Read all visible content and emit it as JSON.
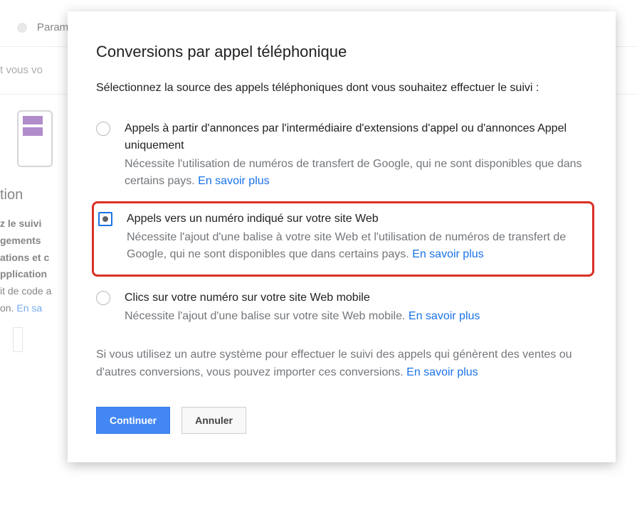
{
  "background": {
    "param_label": "Paramè",
    "row2_text": "t vous vo",
    "action_title": "tion",
    "lines": {
      "l1": "z le suivi",
      "l2": "gements",
      "l3": "ations et c",
      "l4": "pplication",
      "l5a": "it de code a",
      "l5b": "on. ",
      "l5_link": "En sa"
    }
  },
  "modal": {
    "title": "Conversions par appel téléphonique",
    "intro": "Sélectionnez la source des appels téléphoniques dont vous souhaitez effectuer le suivi :",
    "options": [
      {
        "title": "Appels à partir d'annonces par l'intermédiaire d'extensions d'appel ou d'annonces Appel uniquement",
        "desc": "Nécessite l'utilisation de numéros de transfert de Google, qui ne sont disponibles que dans certains pays. ",
        "link": "En savoir plus",
        "selected": false,
        "highlighted": false
      },
      {
        "title": "Appels vers un numéro indiqué sur votre site Web",
        "desc": "Nécessite l'ajout d'une balise à votre site Web et l'utilisation de numéros de transfert de Google, qui ne sont disponibles que dans certains pays. ",
        "link": "En savoir plus",
        "selected": true,
        "highlighted": true
      },
      {
        "title": "Clics sur votre numéro sur votre site Web mobile",
        "desc": "Nécessite l'ajout d'une balise sur votre site Web mobile. ",
        "link": "En savoir plus",
        "selected": false,
        "highlighted": false
      }
    ],
    "footer_text": "Si vous utilisez un autre système pour effectuer le suivi des appels qui génèrent des ventes ou d'autres conversions, vous pouvez importer ces conversions. ",
    "footer_link": "En savoir plus",
    "buttons": {
      "continue": "Continuer",
      "cancel": "Annuler"
    }
  }
}
